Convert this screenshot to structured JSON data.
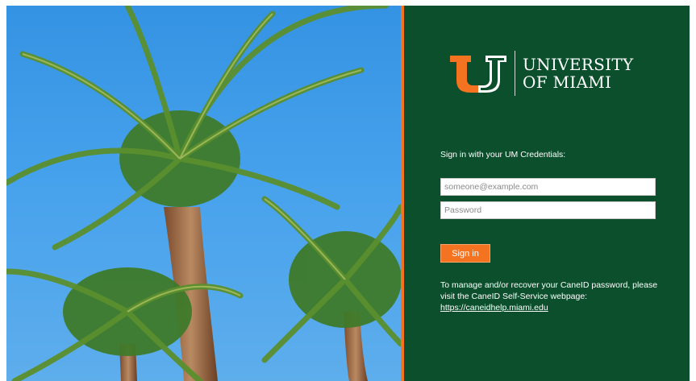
{
  "brand": {
    "name_line1": "UNIVERSITY",
    "name_line2": "OF MIAMI",
    "colors": {
      "green": "#0b4f2c",
      "orange": "#f47321"
    }
  },
  "background_image": {
    "icon": "palm-trees-photo"
  },
  "signin": {
    "intro": "Sign in with your UM Credentials:",
    "email_placeholder": "someone@example.com",
    "email_value": "",
    "password_placeholder": "Password",
    "password_value": "",
    "button_label": "Sign in"
  },
  "help": {
    "line1": "To manage and/or recover your CaneID password, please",
    "line2": "visit the CaneID Self-Service webpage:",
    "link_text": "https://caneidhelp.miami.edu"
  }
}
